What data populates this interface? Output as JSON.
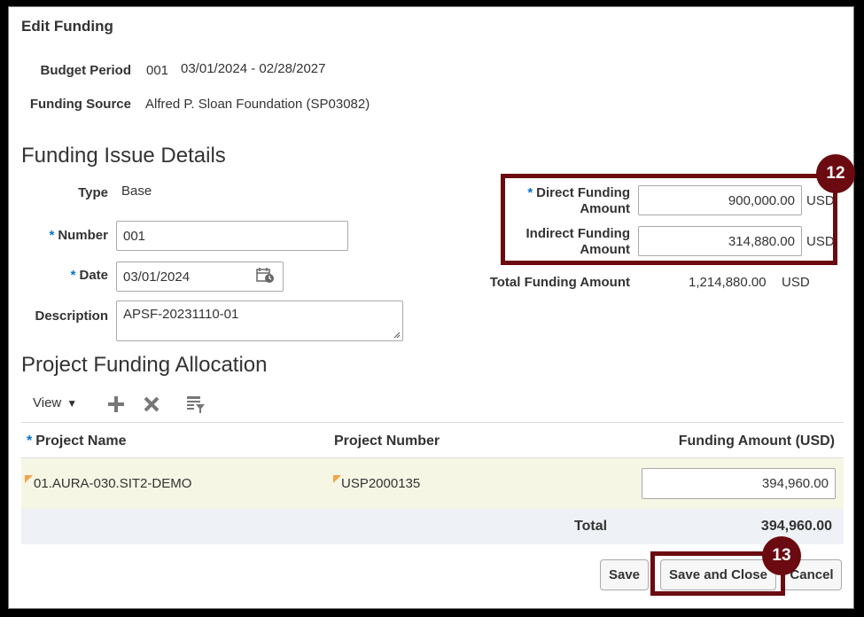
{
  "dialog": {
    "title": "Edit Funding"
  },
  "budget_period": {
    "label": "Budget Period",
    "number": "001",
    "range": "03/01/2024 - 02/28/2027"
  },
  "funding_source": {
    "label": "Funding Source",
    "value": "Alfred P. Sloan Foundation (SP03082)"
  },
  "issue_details": {
    "heading": "Funding Issue Details",
    "type_label": "Type",
    "type_value": "Base",
    "number_label": "Number",
    "number_value": "001",
    "date_label": "Date",
    "date_value": "03/01/2024",
    "description_label": "Description",
    "description_value": "APSF-20231110-01"
  },
  "amounts": {
    "direct_label_1": "Direct Funding",
    "direct_label_2": "Amount",
    "direct_value": "900,000.00",
    "direct_currency": "USD",
    "indirect_label_1": "Indirect Funding",
    "indirect_label_2": "Amount",
    "indirect_value": "314,880.00",
    "indirect_currency": "USD",
    "total_label": "Total Funding Amount",
    "total_value": "1,214,880.00",
    "total_currency": "USD"
  },
  "allocation": {
    "heading": "Project Funding Allocation",
    "toolbar": {
      "view_label": "View"
    },
    "columns": {
      "project_name": "Project Name",
      "project_number": "Project Number",
      "funding_amount": "Funding Amount (USD)"
    },
    "rows": [
      {
        "project_name": "01.AURA-030.SIT2-DEMO",
        "project_number": "USP2000135",
        "funding_amount": "394,960.00"
      }
    ],
    "total_label": "Total",
    "total_value": "394,960.00"
  },
  "buttons": {
    "save": "Save",
    "save_close": "Save and Close",
    "cancel": "Cancel"
  },
  "callouts": {
    "step_12": "12",
    "step_13": "13"
  },
  "colors": {
    "callout": "#6b0a10",
    "required": "#0572ce",
    "row_highlight": "#f6f6e5",
    "total_row": "#eef1f5"
  }
}
